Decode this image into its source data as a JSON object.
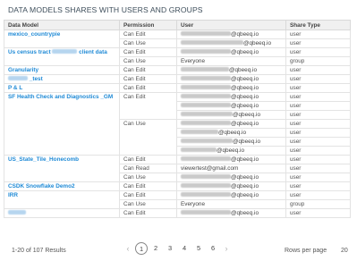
{
  "title": "DATA MODELS SHARES WITH USERS AND GROUPS",
  "columns": [
    "Data Model",
    "Permission",
    "User",
    "Share Type"
  ],
  "groups": [
    {
      "model": "mexico_countrypie",
      "rows": [
        {
          "perm": "Can Edit",
          "user_blur": 56,
          "user_suffix": "@qbeeq.io",
          "stype": "user"
        },
        {
          "perm": "Can Use",
          "user_blur": 70,
          "user_suffix": "@qbeeq.io",
          "stype": "user"
        }
      ]
    },
    {
      "model": "Us census tract",
      "model_blur": 28,
      "model_suffix": "client data",
      "rows": [
        {
          "perm": "Can Edit",
          "user_blur": 56,
          "user_suffix": "@qbeeq.io",
          "stype": "user"
        },
        {
          "perm": "Can Use",
          "user": "Everyone",
          "stype": "group"
        }
      ]
    },
    {
      "model": "Granularity",
      "rows": [
        {
          "perm": "Can Edit",
          "user_blur": 54,
          "user_suffix": "@qbeeq.io",
          "stype": "user"
        }
      ]
    },
    {
      "model_blur": 22,
      "model_suffix": "_test",
      "rows": [
        {
          "perm": "Can Edit",
          "user_blur": 56,
          "user_suffix": "@qbeeq.io",
          "stype": "user"
        }
      ]
    },
    {
      "model": "P & L",
      "rows": [
        {
          "perm": "Can Edit",
          "user_blur": 56,
          "user_suffix": "@qbeeq.io",
          "stype": "user"
        }
      ]
    },
    {
      "model": "SF Health Check and Diagnostics _GM",
      "rows": [
        {
          "perm": "Can Edit",
          "user_blur": 56,
          "user_suffix": "@qbeeq.io",
          "stype": "user"
        },
        {
          "perm": "",
          "user_blur": 56,
          "user_suffix": "@qbeeq.io",
          "stype": "user"
        },
        {
          "perm": "",
          "user_blur": 58,
          "user_suffix": "@qbeeq.io",
          "stype": "user"
        },
        {
          "perm": "Can Use",
          "user_blur": 56,
          "user_suffix": "@qbeeq.io",
          "stype": "user"
        },
        {
          "perm": "",
          "user_blur": 42,
          "user_suffix": "@qbeeq.io",
          "stype": "user"
        },
        {
          "perm": "",
          "user_blur": 58,
          "user_suffix": "@qbeeq.io",
          "stype": "user"
        },
        {
          "perm": "",
          "user_blur": 40,
          "user_suffix": "@qbeeq.io",
          "stype": "user"
        }
      ]
    },
    {
      "model": "US_State_Tile_Honecomb",
      "rows": [
        {
          "perm": "Can Edit",
          "user_blur": 56,
          "user_suffix": "@qbeeq.io",
          "stype": "user"
        },
        {
          "perm": "Can Read",
          "user": "viewertest@gmail.com",
          "stype": "user"
        },
        {
          "perm": "Can Use",
          "user_blur": 56,
          "user_suffix": "@qbeeq.io",
          "stype": "user"
        }
      ]
    },
    {
      "model": "CSDK Snowflake Demo2",
      "rows": [
        {
          "perm": "Can Edit",
          "user_blur": 56,
          "user_suffix": "@qbeeq.io",
          "stype": "user"
        }
      ]
    },
    {
      "model": "IRR",
      "rows": [
        {
          "perm": "Can Edit",
          "user_blur": 56,
          "user_suffix": "@qbeeq.io",
          "stype": "user"
        },
        {
          "perm": "Can Use",
          "user": "Everyone",
          "stype": "group"
        }
      ]
    },
    {
      "model_blur": 20,
      "rows": [
        {
          "perm": "Can Edit",
          "user_blur": 56,
          "user_suffix": "@qbeeq.io",
          "stype": "user"
        }
      ]
    }
  ],
  "footer": {
    "results": "1-20 of 107 Results",
    "pages": [
      "1",
      "2",
      "3",
      "4",
      "5",
      "6"
    ],
    "active_page": "1",
    "prev_icon": "‹",
    "next_icon": "›",
    "rows_per_page_label": "Rows per page",
    "rows_per_page_value": "20"
  }
}
